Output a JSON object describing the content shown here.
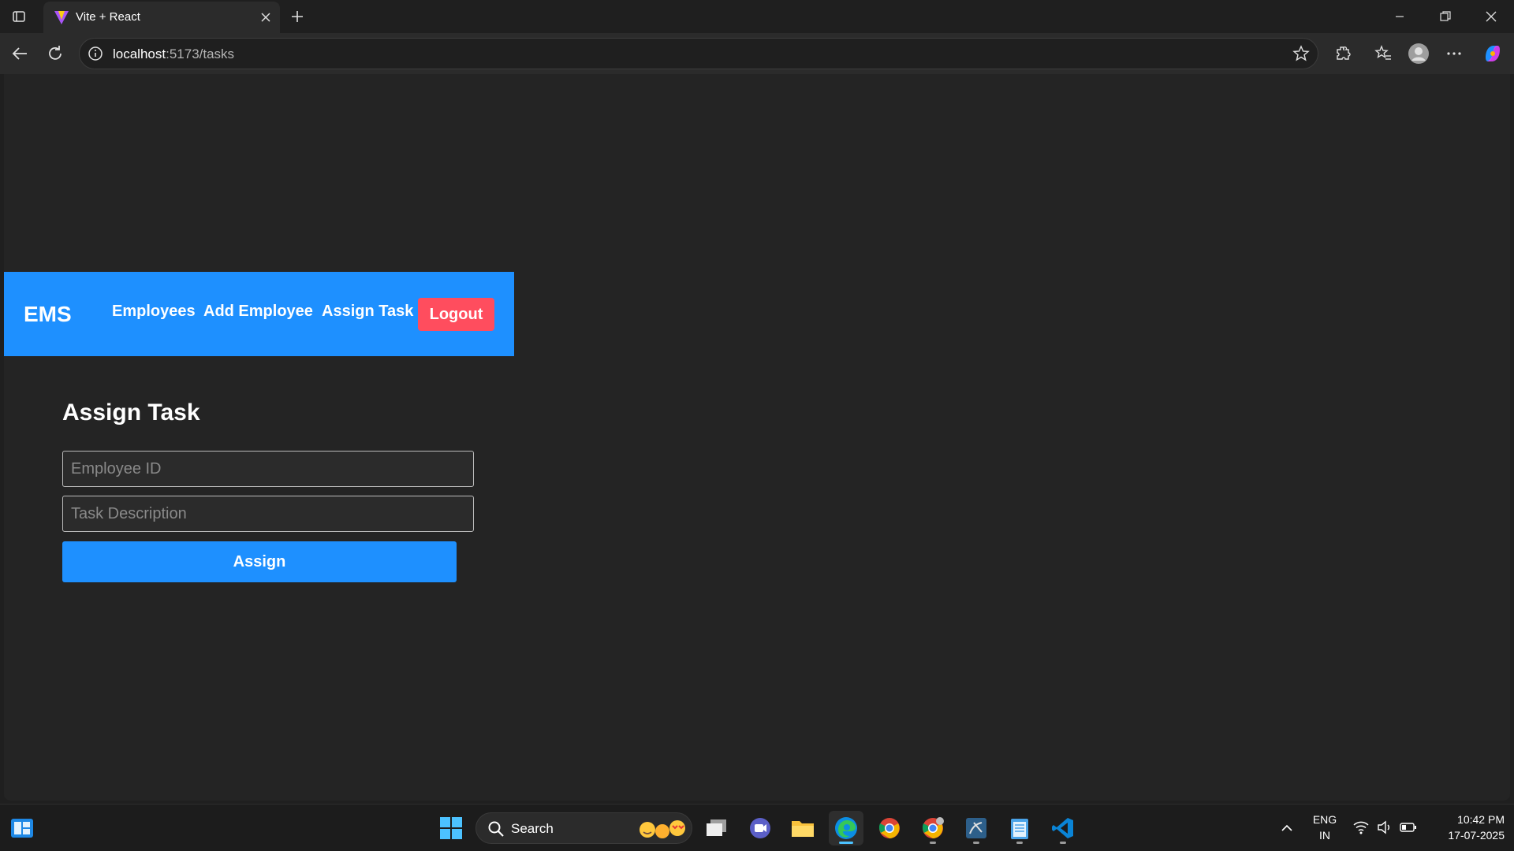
{
  "browser": {
    "tab_title": "Vite + React",
    "url_host": "localhost",
    "url_rest": ":5173/tasks"
  },
  "app": {
    "brand": "EMS",
    "nav": {
      "employees": "Employees",
      "add_employee": "Add Employee",
      "assign_task": "Assign Task",
      "logout": "Logout"
    },
    "form": {
      "title": "Assign Task",
      "employee_id_placeholder": "Employee ID",
      "employee_id_value": "",
      "task_description_placeholder": "Task Description",
      "task_description_value": "",
      "submit_label": "Assign"
    },
    "colors": {
      "navbar": "#1e90ff",
      "logout": "#ff4d5e",
      "page_bg": "#242424"
    }
  },
  "taskbar": {
    "search_label": "Search",
    "language": "ENG",
    "region": "IN",
    "time": "10:42 PM",
    "date": "17-07-2025"
  }
}
